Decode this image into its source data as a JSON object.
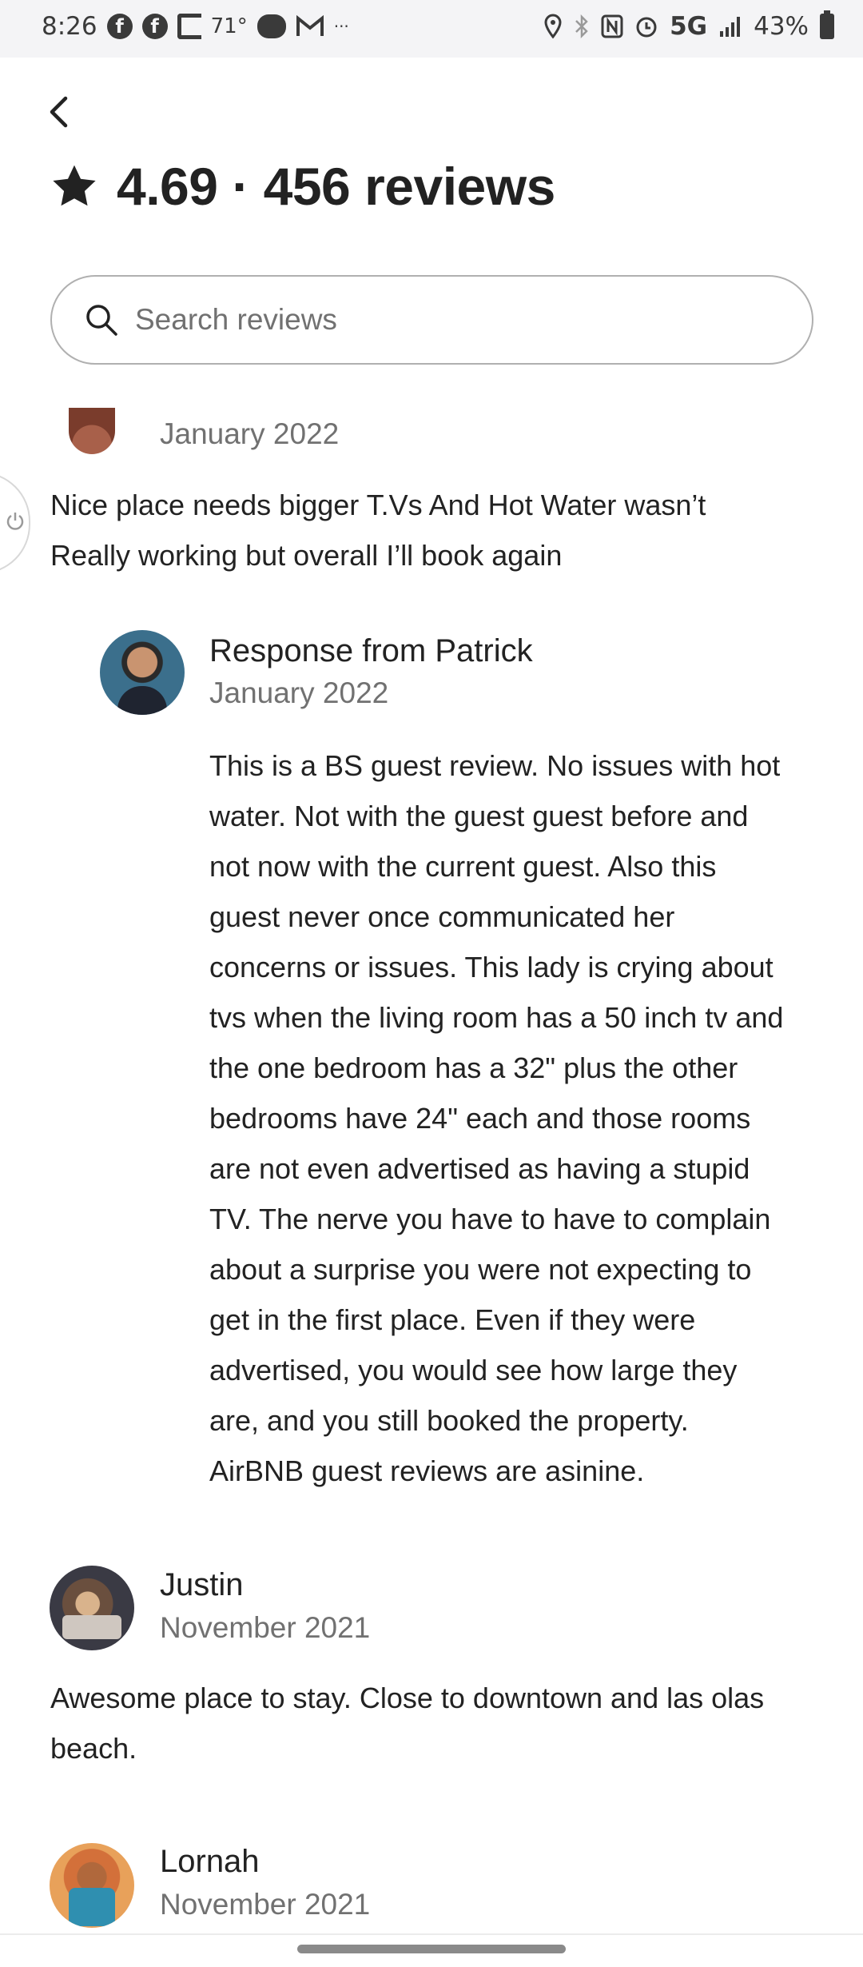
{
  "status_bar": {
    "time": "8:26",
    "temperature": "71°",
    "more": "···",
    "network": "5G",
    "battery": "43%",
    "icons": [
      "facebook-icon",
      "facebook-icon",
      "c-icon",
      "weather-icon",
      "gmail-icon",
      "location-icon",
      "bluetooth-icon",
      "nfc-icon",
      "alarm-icon",
      "signal-icon",
      "battery-icon"
    ]
  },
  "header": {
    "rating": "4.69",
    "separator": "·",
    "review_count": "456 reviews"
  },
  "search": {
    "placeholder": "Search reviews"
  },
  "reviews": [
    {
      "name": "",
      "date": "January 2022",
      "lines": [
        "Nice place needs bigger T.Vs And Hot Water wasn’t",
        "Really working but overall I’ll book again"
      ],
      "response": {
        "title": "Response from Patrick",
        "date": "January 2022",
        "lines": [
          "This is a BS guest review. No issues with hot",
          "water. Not with the guest guest before and",
          "not now with the current guest. Also this",
          "guest never once communicated her",
          "concerns or issues. This lady is crying about",
          "tvs when the living room has a 50 inch tv and",
          "the one bedroom has a 32\" plus the other",
          "bedrooms have 24\" each and those rooms",
          "are not even advertised as having a stupid",
          "TV. The nerve you have to have to complain",
          "about a surprise you were not expecting to",
          "get in the first place. Even if they were",
          "advertised, you would see how large they",
          "are, and you still booked the property.",
          "AirBNB guest reviews are asinine."
        ]
      }
    },
    {
      "name": "Justin",
      "date": "November 2021",
      "lines": [
        "Awesome place to stay. Close to downtown and las olas",
        "beach."
      ]
    },
    {
      "name": "Lornah",
      "date": "November 2021",
      "lines": []
    }
  ],
  "colors": {
    "text": "#222222",
    "secondary_text": "#717171",
    "border": "#b0b0b0"
  }
}
